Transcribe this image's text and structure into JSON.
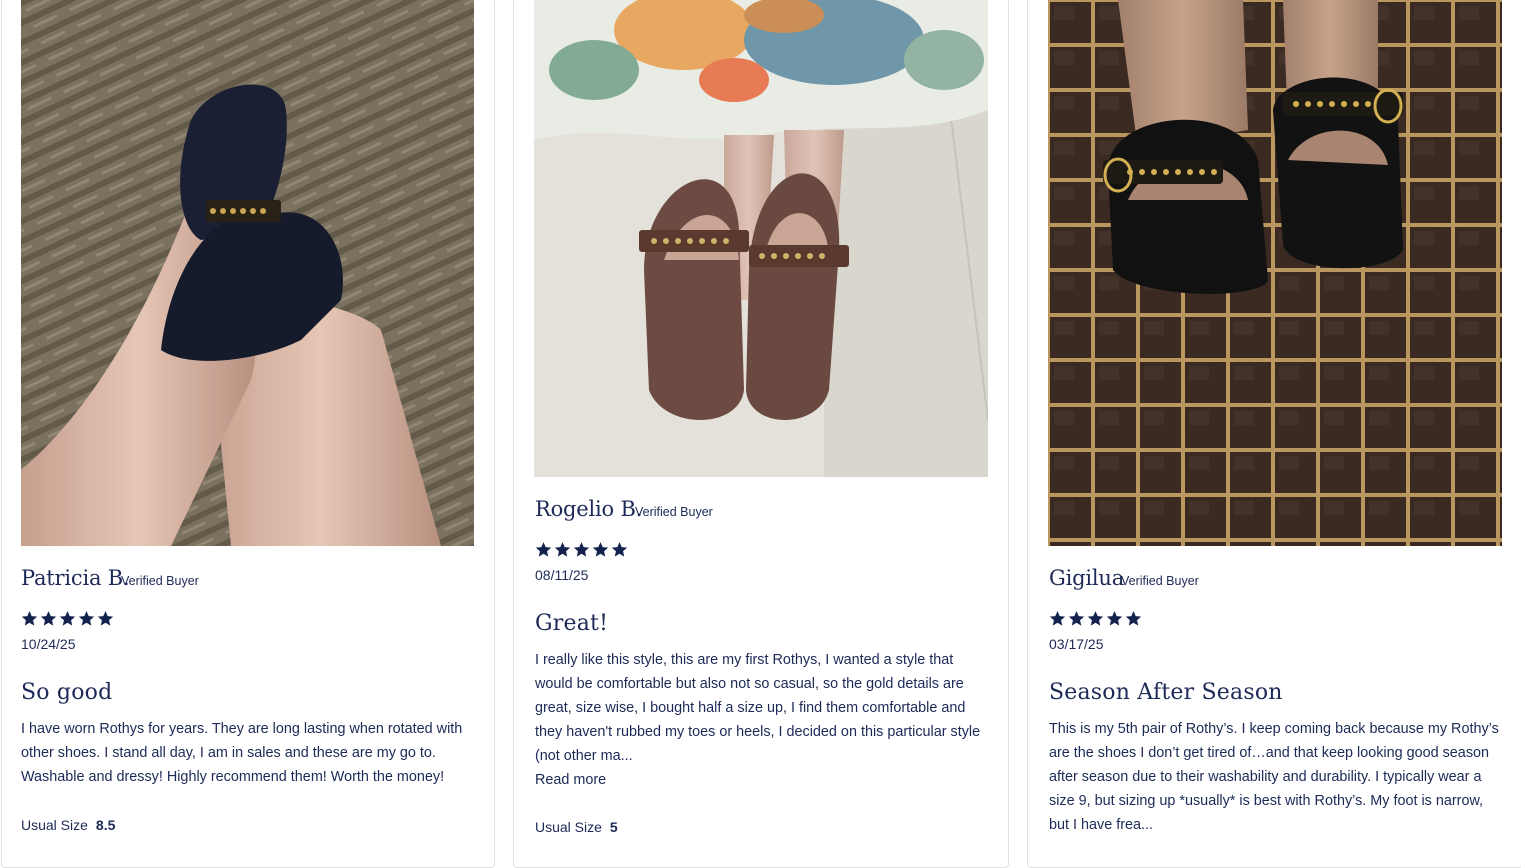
{
  "colors": {
    "text": "#1d2a57",
    "star": "#14224e",
    "border": "#e1e1e4"
  },
  "reviews": [
    {
      "photo_icon": "review-photo",
      "name": "Patricia B.",
      "verified": "Verified Buyer",
      "rating": 5,
      "date": "10/24/25",
      "title": "So good",
      "body": "I have worn Rothys for years. They are long lasting when rotated with other shoes. I stand all day, I am in sales and these are my go to. Washable and dressy! Highly recommend them! Worth the money!",
      "size_label": "Usual Size",
      "size_value": "8.5"
    },
    {
      "photo_icon": "review-photo",
      "name": "Rogelio B.",
      "verified": "Verified Buyer",
      "rating": 5,
      "date": "08/11/25",
      "title": "Great!",
      "body": "I really like this style, this are my first Rothys, I wanted a style that would be comfortable but also not so casual, so the gold details are great, size wise, I bought half a size up, I find them comfortable and they haven't rubbed my toes or heels, I decided on this particular style (not other ma...",
      "read_more": "Read more",
      "size_label": "Usual Size",
      "size_value": "5"
    },
    {
      "photo_icon": "review-photo",
      "name": "Gigilua",
      "verified": "Verified Buyer",
      "rating": 5,
      "date": "03/17/25",
      "title": "Season After Season",
      "body": "This is my 5th pair of Rothy’s. I keep coming back because my Rothy’s are the shoes I don’t get tired of…and that keep looking good season after season due to their washability and durability. I typically wear a size 9, but sizing up *usually* is best with Rothy’s. My foot is narrow, but I have frea..."
    }
  ]
}
